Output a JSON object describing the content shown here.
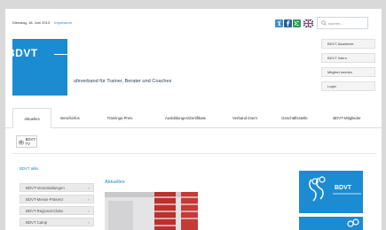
{
  "topbar": {
    "date": "Dienstag, 18. Juni 2013",
    "impressum": "Impressum",
    "social": [
      "xing-icon",
      "facebook-icon",
      "twitter-icon",
      "uk-flag-icon"
    ],
    "search_placeholder": "suchen..."
  },
  "header": {
    "logo_text": "BDVT",
    "tagline": "ufsverband für Trainer, Berater und Coaches",
    "side_buttons": [
      "BDVT-Akademie",
      "BDVT Intern",
      "Mitglied werden",
      "Login"
    ]
  },
  "nav": {
    "tabs": [
      "Aktuelles",
      "Berufsinfos",
      "Trainings-Preis",
      "Ausbildungen/Zertifikate",
      "Verband intern",
      "Geschäftsstelle",
      "BDVT-Mitglieder"
    ],
    "active": "Aktuelles"
  },
  "tv": {
    "label": "BDVT-TV"
  },
  "sidebar": {
    "title": "BDVT aktiv",
    "items": [
      "BDVT-Veranstaltungen",
      "BDVT-Messe-Präsenz",
      "BDVT-Regional-Clubs",
      "BDVT Camp"
    ]
  },
  "main": {
    "title": "Aktuelles"
  },
  "promo": {
    "text": "BDVT"
  },
  "colors": {
    "accent": "#1b8bd2",
    "link": "#1a8bc3"
  }
}
